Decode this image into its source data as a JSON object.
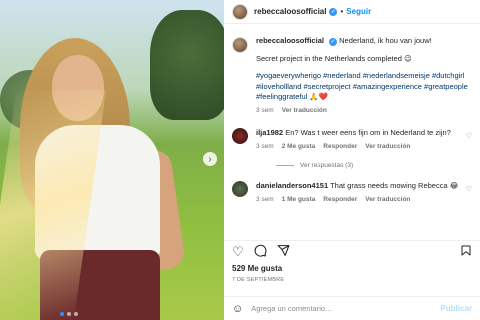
{
  "header": {
    "username": "rebeccaloosofficial",
    "separator": "•",
    "follow_label": "Seguir"
  },
  "caption": {
    "username": "rebeccaloosofficial",
    "text1": "Nederland, ik hou van jouw!",
    "text2": "Secret project in the Netherlands completed 😉",
    "hashtags": "#yogaeverywherigo #nederland #nederlandsemeisje #dutchgirl #ilovehollland #secretproject #amazingexperience #greatpeople #feelinggrateful 🙏❤️",
    "time": "3 sem",
    "translate": "Ver traducción"
  },
  "comments": [
    {
      "username": "ilja1982",
      "text": "En? Was t weer eens fijn om in Nederland te zijn?",
      "time": "3 sem",
      "likes": "2 Me gusta",
      "reply": "Responder",
      "translate": "Ver traducción"
    },
    {
      "username": "danielanderson4151",
      "text": "That grass needs mowing Rebecca 😂",
      "time": "3 sem",
      "likes": "1 Me gusta",
      "reply": "Responder",
      "translate": "Ver traducción"
    }
  ],
  "replies_label": "Ver respuestas (3)",
  "likes_count": "529 Me gusta",
  "date": "7 DE SEPTIEMBRE",
  "add_comment": {
    "placeholder": "Agrega un comentario...",
    "publish": "Publicar"
  },
  "icons": {
    "like": "heart-icon",
    "comment": "comment-icon",
    "share": "share-icon",
    "save": "bookmark-icon",
    "emoji": "emoji-icon",
    "next": "chevron-right-icon"
  },
  "colors": {
    "link": "#0095f6",
    "hashtag": "#00376b",
    "verified": "#3897f0"
  }
}
